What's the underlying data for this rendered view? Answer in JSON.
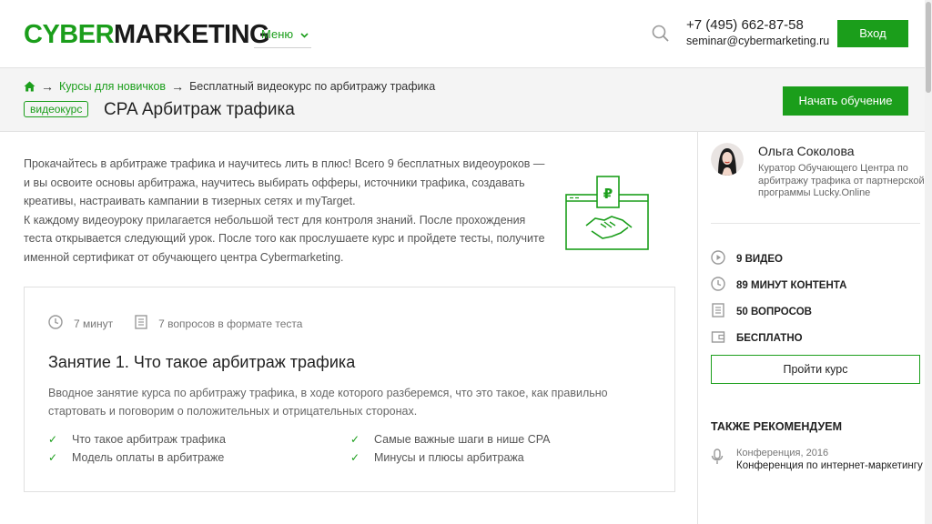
{
  "header": {
    "logo_part1": "CYBER",
    "logo_part2": "MARKETING",
    "menu_label": "Меню",
    "phone": "+7 (495) 662-87-58",
    "email": "seminar@cybermarketing.ru",
    "login_label": "Вход"
  },
  "breadcrumb": {
    "items": [
      "Курсы для новичков",
      "Бесплатный видеокурс по арбитражу трафика"
    ],
    "separator": "→"
  },
  "course": {
    "badge": "видеокурс",
    "title": "CPA Арбитраж трафика",
    "start_label": "Начать обучение",
    "intro_p1": "Прокачайтесь в арбитраже трафика и научитесь лить в плюс! Всего 9 бесплатных видеоуроков — и вы освоите основы арбитража, научитесь выбирать офферы, источники трафика, создавать креативы, настраивать кампании в тизерных сетях и myTarget.",
    "intro_p2": "К каждому видеоуроку прилагается небольшой тест для контроля знаний. После прохождения теста открывается следующий урок. После того как прослушаете курс и пройдете тесты, получите именной сертификат от обучающего центра Cybermarketing."
  },
  "lesson": {
    "duration": "7 минут",
    "questions": "7 вопросов в формате теста",
    "title": "Занятие 1. Что такое арбитраж трафика",
    "description": "Вводное занятие курса по арбитражу трафика, в ходе которого разберемся, что это такое, как правильно стартовать и поговорим о положительных и отрицательных сторонах.",
    "points": [
      "Что такое арбитраж трафика",
      "Самые важные шаги в нише CPA",
      "Модель оплаты в арбитраже",
      "Минусы и плюсы арбитража"
    ]
  },
  "sidebar": {
    "author_name": "Ольга Соколова",
    "author_role": "Куратор Обучающего Центра по арбитражу трафика от партнерской программы Lucky.Online",
    "stats": [
      "9 ВИДЕО",
      "89 МИНУТ КОНТЕНТА",
      "50 ВОПРОСОВ",
      "БЕСПЛАТНО"
    ],
    "course_button": "Пройти курс",
    "recommend_title": "ТАКЖЕ РЕКОМЕНДУЕМ",
    "rec_meta": "Конференция, 2016",
    "rec_name": "Конференция по интернет-маркетингу"
  },
  "colors": {
    "brand_green": "#1b9e1b",
    "text_dark": "#222222",
    "band_gray": "#f4f4f4"
  },
  "icons": [
    "search-icon",
    "home-icon",
    "clock-icon",
    "document-icon",
    "check-icon",
    "play-icon",
    "wallet-icon",
    "microphone-icon",
    "handshake-icon",
    "ruble-icon"
  ]
}
